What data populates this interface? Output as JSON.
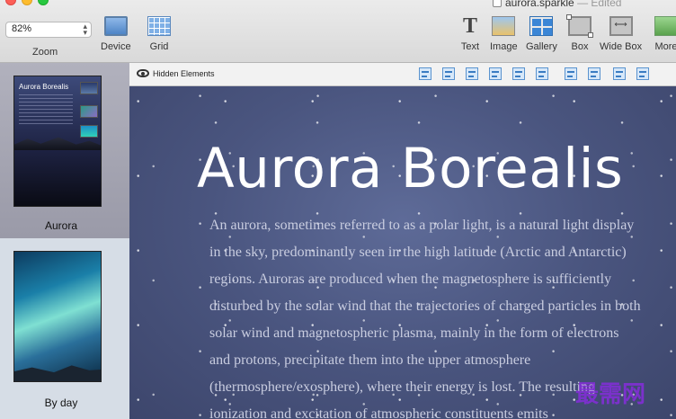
{
  "window": {
    "document_title": "aurora.sparkle",
    "status": "— Edited"
  },
  "toolbar": {
    "zoom_value": "82%",
    "zoom_label": "Zoom",
    "device_label": "Device",
    "grid_label": "Grid",
    "text_label": "Text",
    "image_label": "Image",
    "gallery_label": "Gallery",
    "box_label": "Box",
    "widebox_label": "Wide Box",
    "more_label": "More"
  },
  "subbar": {
    "hidden_elements_label": "Hidden Elements"
  },
  "sidebar": {
    "pages": [
      {
        "label": "Aurora",
        "thumb_title": "Aurora Borealis",
        "selected": true
      },
      {
        "label": "By day",
        "selected": false
      }
    ]
  },
  "canvas": {
    "title": "Aurora Borealis",
    "body": "An aurora, sometimes referred to as a polar light, is a natural light display in the sky, predominantly seen in the high latitude (Arctic and Antarctic) regions. Auroras are produced when the magnetosphere is sufficiently disturbed by the solar wind that the trajectories of charged particles in both solar wind and magnetospheric plasma, mainly in the form of electrons and protons, precipitate them into the upper atmosphere (thermosphere/exosphere), where their energy is lost. The resulting ionization and excitation of atmospheric constituents emits"
  },
  "watermark": "最需网",
  "colors": {
    "close": "#fc5f57",
    "minimize": "#fdbc2e",
    "zoom": "#28c840",
    "canvas_bg": "#4a557f",
    "accent": "#3b86d6"
  }
}
